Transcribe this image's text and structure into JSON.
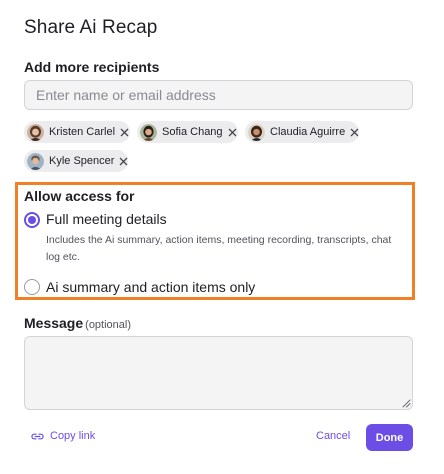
{
  "dialog": {
    "title": "Share Ai Recap"
  },
  "recipients": {
    "label": "Add more recipients",
    "input_placeholder": "Enter name or email address",
    "chips": [
      {
        "name": "Kristen Carlel"
      },
      {
        "name": "Sofia Chang"
      },
      {
        "name": "Claudia Aguirre"
      },
      {
        "name": "Kyle Spencer"
      }
    ]
  },
  "access": {
    "label": "Allow access for",
    "options": [
      {
        "label": "Full meeting details",
        "description": "Includes the Ai summary, action items, meeting recording, transcripts, chat log etc.",
        "selected": true
      },
      {
        "label": "Ai summary and action items only",
        "selected": false
      }
    ]
  },
  "message": {
    "label": "Message",
    "optional_note": "(optional)",
    "value": ""
  },
  "footer": {
    "copy_link_label": "Copy link",
    "cancel_label": "Cancel",
    "done_label": "Done"
  },
  "colors": {
    "accent": "#6c4de6",
    "highlight_border": "#f07f26",
    "chip_bg": "#ececef",
    "input_bg": "#f4f4f5"
  },
  "icons": {
    "chip_remove": "close-icon",
    "copy_link": "link-icon",
    "textarea_resize": "resize-grip-icon"
  }
}
